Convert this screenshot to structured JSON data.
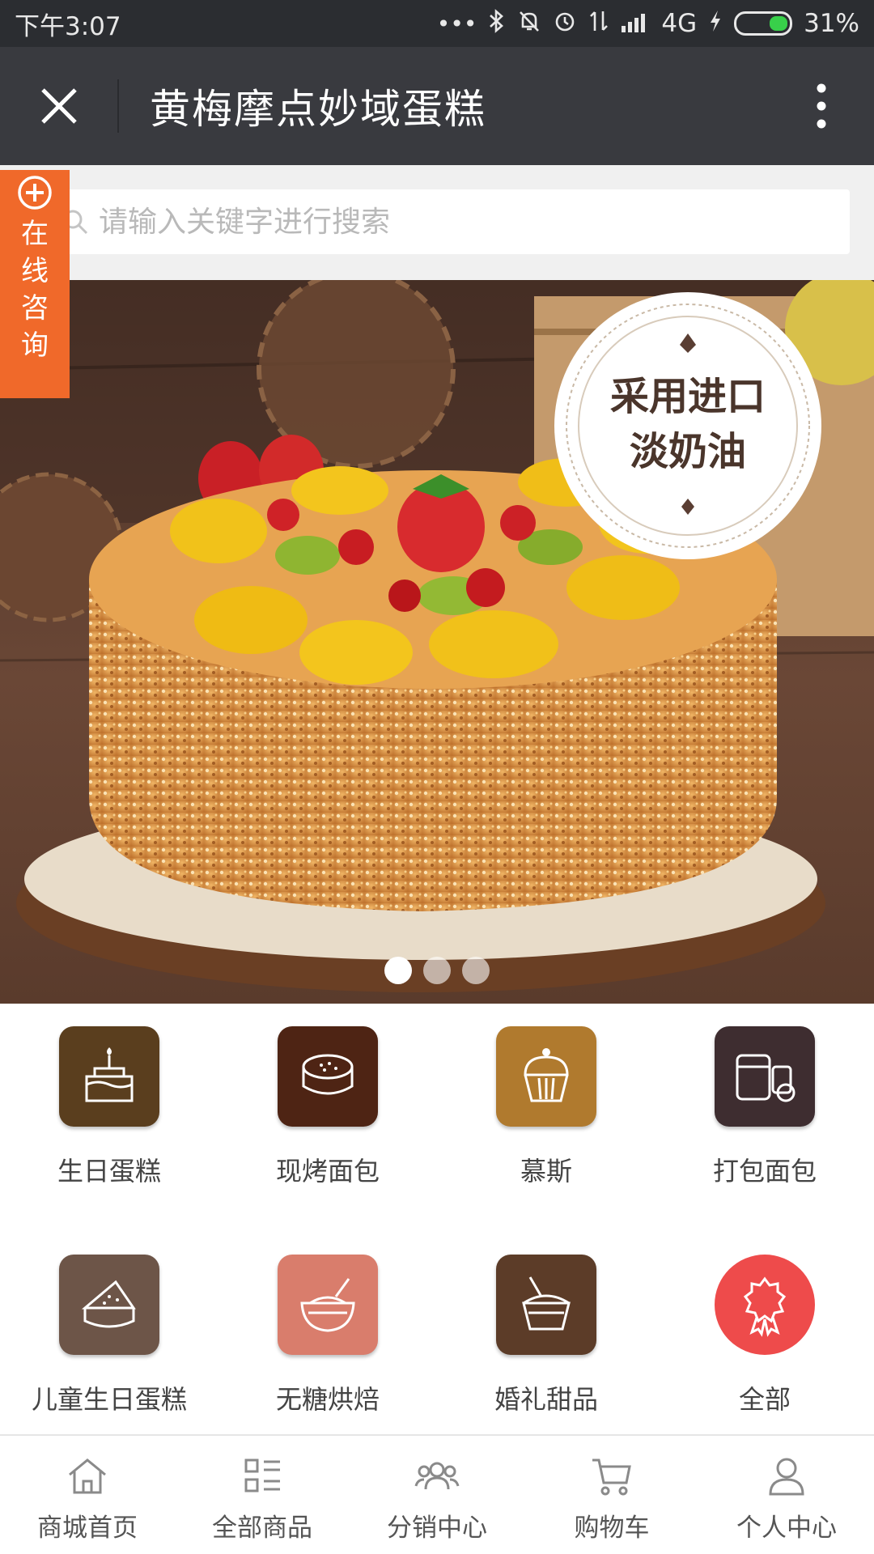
{
  "status_bar": {
    "time": "下午3:07",
    "network": "4G",
    "battery": "31%",
    "icons": [
      "more-dots-icon",
      "bluetooth-icon",
      "mute-icon",
      "alarm-icon",
      "data-arrows-icon",
      "signal-icon",
      "charging-icon",
      "battery-icon"
    ]
  },
  "header": {
    "title": "黄梅摩点妙域蛋糕"
  },
  "search": {
    "placeholder": "请输入关键字进行搜索"
  },
  "consult": {
    "label": "在线咨询"
  },
  "banner": {
    "badge_line1": "采用进口",
    "badge_line2": "淡奶油",
    "slide_count": 3,
    "active_slide": 1
  },
  "categories": [
    {
      "label": "生日蛋糕",
      "icon": "birthday-cake-icon",
      "color": "#5a3e1e"
    },
    {
      "label": "现烤面包",
      "icon": "bread-icon",
      "color": "#4e2414"
    },
    {
      "label": "慕斯",
      "icon": "cupcake-icon",
      "color": "#b07a2e"
    },
    {
      "label": "打包面包",
      "icon": "packaged-bread-icon",
      "color": "#3e2d30"
    },
    {
      "label": "儿童生日蛋糕",
      "icon": "cake-slice-icon",
      "color": "#6d5548"
    },
    {
      "label": "无糖烘焙",
      "icon": "mixing-bowl-icon",
      "color": "#d97d6c"
    },
    {
      "label": "婚礼甜品",
      "icon": "dessert-cup-icon",
      "color": "#5c3c28"
    },
    {
      "label": "全部",
      "icon": "award-icon",
      "color": "#ee4b4b"
    }
  ],
  "bottom_nav": [
    {
      "label": "商城首页",
      "icon": "home-icon"
    },
    {
      "label": "全部商品",
      "icon": "list-icon"
    },
    {
      "label": "分销中心",
      "icon": "group-icon"
    },
    {
      "label": "购物车",
      "icon": "cart-icon"
    },
    {
      "label": "个人中心",
      "icon": "user-icon"
    }
  ],
  "colors": {
    "title_bar": "#393a3f",
    "accent": "#f0692a"
  }
}
